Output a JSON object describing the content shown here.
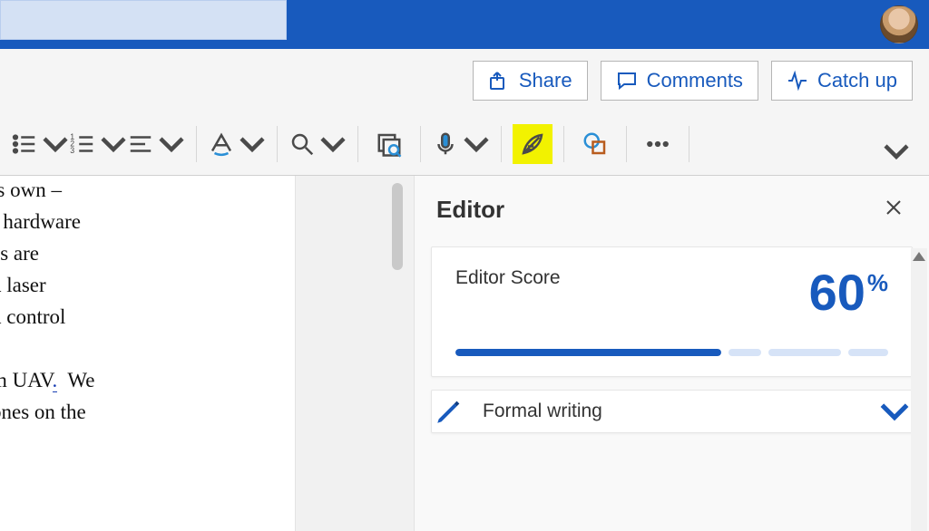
{
  "header": {
    "share": "Share",
    "comments": "Comments",
    "catchup": "Catch up"
  },
  "document": {
    "line1": "ts own –",
    "line2": "f hardware",
    "line3": "es are",
    "line4": "d laser",
    "line5": "d control",
    "line7": "m UAV",
    "line7b": ".",
    "line7c": "  We",
    "line8": "ones on the"
  },
  "editor": {
    "title": "Editor",
    "score_label": "Editor Score",
    "score_value": "60",
    "score_pct": "%",
    "formal_label": "Formal writing"
  }
}
